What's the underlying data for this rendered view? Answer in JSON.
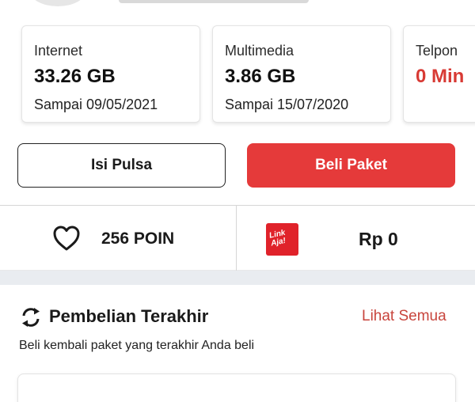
{
  "quota_cards": [
    {
      "label": "Internet",
      "value": "33.26 GB",
      "expiry": "Sampai 09/05/2021"
    },
    {
      "label": "Multimedia",
      "value": "3.86 GB",
      "expiry": "Sampai 15/07/2020"
    },
    {
      "label": "Telpon",
      "value": "0 Min",
      "expiry": ""
    }
  ],
  "actions": {
    "top_up_label": "Isi Pulsa",
    "buy_package_label": "Beli Paket"
  },
  "rewards": {
    "points_text": "256 POIN",
    "linkaja_logo_text": "Link Aja!",
    "balance_text": "Rp 0"
  },
  "recent": {
    "title": "Pembelian Terakhir",
    "see_all_label": "Lihat Semua",
    "subtitle": "Beli kembali paket yang terakhir Anda beli"
  },
  "colors": {
    "brand_red": "#e53a3a",
    "link_red": "#c8453d",
    "alert_red": "#d83a34"
  },
  "icons": {
    "points": "heart-icon",
    "wallet": "linkaja-logo",
    "recent": "refresh-icon"
  }
}
